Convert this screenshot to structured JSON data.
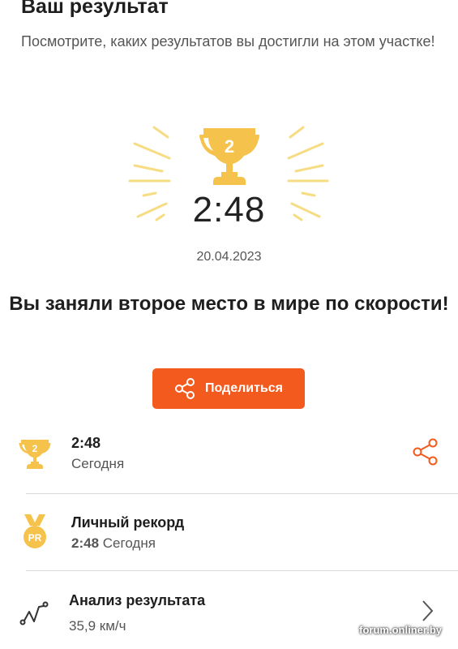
{
  "header": {
    "title": "Ваш результат",
    "subtitle": "Посмотрите, каких результатов вы достигли на этом участке!"
  },
  "hero": {
    "trophy_place": "2",
    "time": "2:48",
    "date": "20.04.2023",
    "icon": "trophy-icon"
  },
  "headline": "Вы заняли второе место в мире по скорости!",
  "share_button": {
    "label": "Поделиться",
    "icon": "share-icon"
  },
  "results": [
    {
      "icon": "trophy-icon",
      "place": "2",
      "title": "2:48",
      "subtitle": "Сегодня",
      "action_icon": "share-icon"
    },
    {
      "icon": "pr-medal-icon",
      "badge": "PR",
      "title": "Личный рекорд",
      "value": "2:48",
      "subtitle": "Сегодня"
    },
    {
      "icon": "analysis-graph-icon",
      "title": "Анализ результата",
      "subtitle": "35,9 км/ч",
      "action_icon": "chevron-right-icon"
    }
  ],
  "watermark": "forum.onliner.by",
  "colors": {
    "accent": "#f25a1e",
    "gold": "#f5c24c",
    "ray": "#f6dc82",
    "text": "#1e1e1e",
    "muted": "#555555",
    "divider": "#d9d9d9"
  }
}
